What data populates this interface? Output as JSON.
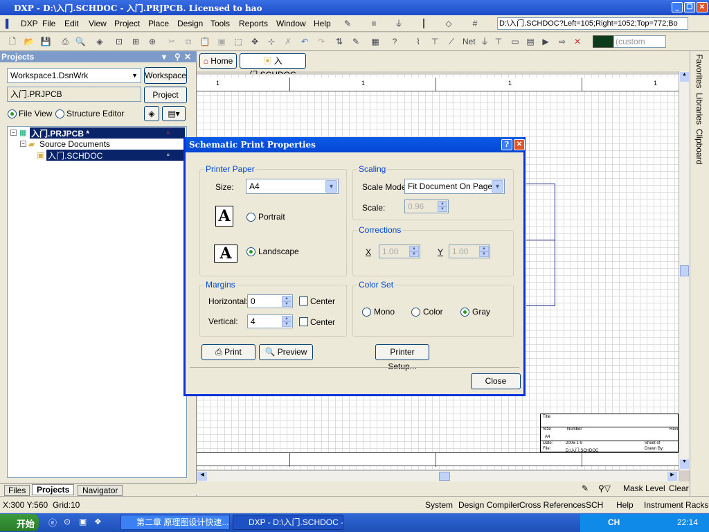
{
  "window": {
    "title": "DXP - D:\\入门.SCHDOC - 入门.PRJPCB. Licensed to hao"
  },
  "menu": {
    "items": [
      "DXP",
      "File",
      "Edit",
      "View",
      "Project",
      "Place",
      "Design",
      "Tools",
      "Reports",
      "Window",
      "Help"
    ]
  },
  "toolbar": {
    "path_combo": "D:\\入门.SCHDOC?Left=105;Right=1052;Top=772;Bo",
    "custom_combo": "(custom"
  },
  "projects_panel": {
    "title": "Projects",
    "workspace_field": "Workspace1.DsnWrk",
    "workspace_button": "Workspace",
    "project_field": "入门.PRJPCB",
    "project_button": "Project",
    "file_view": "File View",
    "structure_editor": "Structure Editor",
    "tree": {
      "root": "入门.PRJPCB *",
      "folder": "Source Documents",
      "doc": "入门.SCHDOC"
    },
    "tabs": [
      "Files",
      "Projects",
      "Navigator"
    ]
  },
  "doc_tabs": {
    "home": "Home",
    "doc": "入门.SCHDOC"
  },
  "ruler": {
    "marks": [
      "1",
      "1",
      "1",
      "1"
    ]
  },
  "right_tabs": [
    "Favorites",
    "Libraries",
    "Clipboard"
  ],
  "canvas_bottom": {
    "mask_level": "Mask Level",
    "clear": "Clear"
  },
  "title_block": {
    "title": "Title",
    "size": "Size",
    "number": "Number",
    "revision": "Revision",
    "size_val": "A4",
    "date": "Date:",
    "date_val": "2006-1-9",
    "file": "File:",
    "file_val": "D:\\入门.SCHDOC",
    "sheet": "Sheet of",
    "drawn": "Drawn By:"
  },
  "statusbar": {
    "coords": "X:300 Y:560",
    "grid": "Grid:10",
    "items": [
      "System",
      "Design Compiler",
      "Cross References",
      "SCH",
      "Help",
      "Instrument Racks"
    ]
  },
  "taskbar": {
    "start": "开始",
    "task1": "第二章 原理图设计快速...",
    "task2": "DXP - D:\\入门.SCHDOC - ...",
    "clock": "22:14",
    "ime": "CH"
  },
  "dialog": {
    "title": "Schematic Print Properties",
    "printer_paper": {
      "label": "Printer Paper",
      "size_label": "Size:",
      "size_value": "A4",
      "portrait": "Portrait",
      "landscape": "Landscape",
      "selected": "Landscape"
    },
    "scaling": {
      "label": "Scaling",
      "mode_label": "Scale Mode",
      "mode_value": "Fit Document On Page",
      "scale_label": "Scale:",
      "scale_value": "0.96"
    },
    "corrections": {
      "label": "Corrections",
      "x_label": "X",
      "x_value": "1.00",
      "y_label": "Y",
      "y_value": "1.00"
    },
    "margins": {
      "label": "Margins",
      "h_label": "Horizontal:",
      "h_value": "0",
      "v_label": "Vertical:",
      "v_value": "4",
      "center": "Center"
    },
    "color_set": {
      "label": "Color Set",
      "mono": "Mono",
      "color": "Color",
      "gray": "Gray",
      "selected": "Gray"
    },
    "buttons": {
      "print": "Print",
      "preview": "Preview",
      "printer_setup": "Printer Setup...",
      "close": "Close"
    }
  }
}
